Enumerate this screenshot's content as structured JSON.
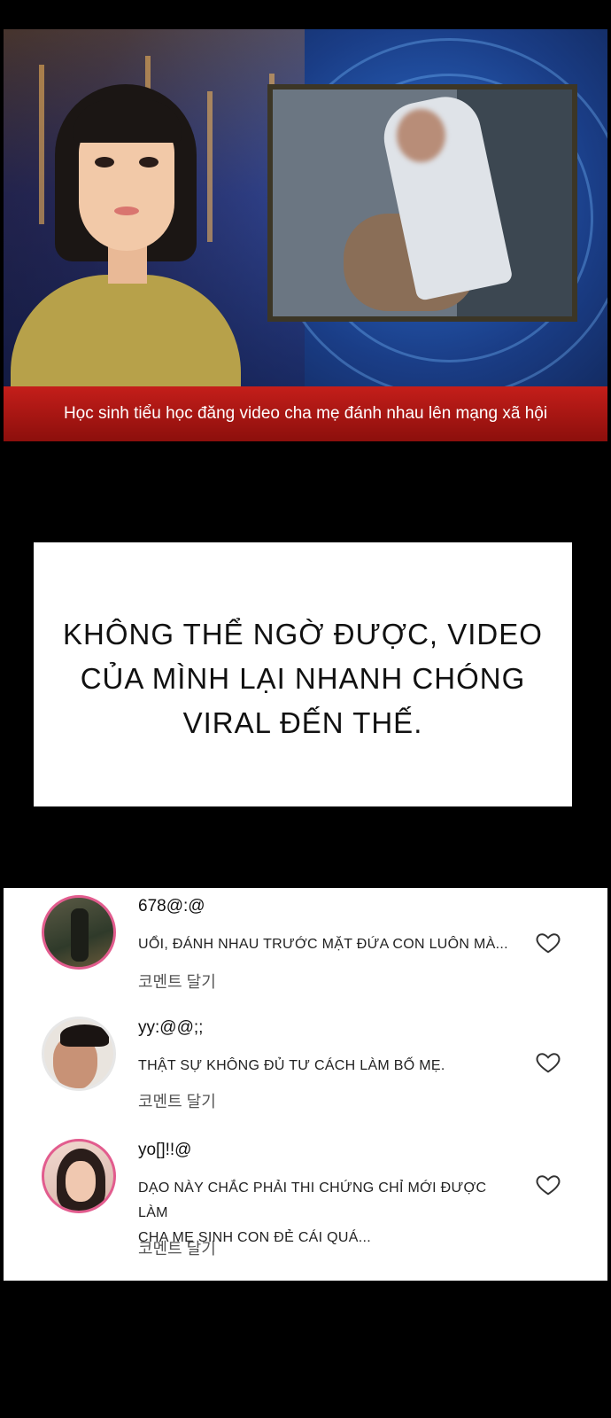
{
  "news_caption": "Học sinh tiểu học đăng video cha mẹ đánh nhau lên mạng xã hội",
  "narration": [
    "KHÔNG THỂ NGỜ ĐƯỢC, VIDEO",
    "CỦA MÌNH LẠI NHANH CHÓNG",
    "VIRAL ĐẾN THẾ."
  ],
  "comments": [
    {
      "user": "678@:@",
      "text_lines": [
        "UỔI, ĐÁNH NHAU TRƯỚC MẶT ĐỨA CON LUÔN MÀ..."
      ],
      "reply": "코멘트 달기"
    },
    {
      "user": "yy:@@;;",
      "text_lines": [
        "THẬT SỰ KHÔNG ĐỦ TƯ CÁCH LÀM BỐ MẸ."
      ],
      "reply": "코멘트 달기"
    },
    {
      "user": "yo[]!!@",
      "text_lines": [
        "DẠO NÀY CHẮC PHẢI THI CHỨNG CHỈ MỚI ĐƯỢC LÀM",
        "CHA MẸ SINH CON ĐẺ CÁI QUÁ..."
      ],
      "reply": "코멘트 달기"
    }
  ],
  "colors": {
    "caption_bar": "#c41e1a",
    "avatar_ring": "#e25c8e",
    "background": "#000000"
  },
  "icons": [
    "heart-icon"
  ]
}
